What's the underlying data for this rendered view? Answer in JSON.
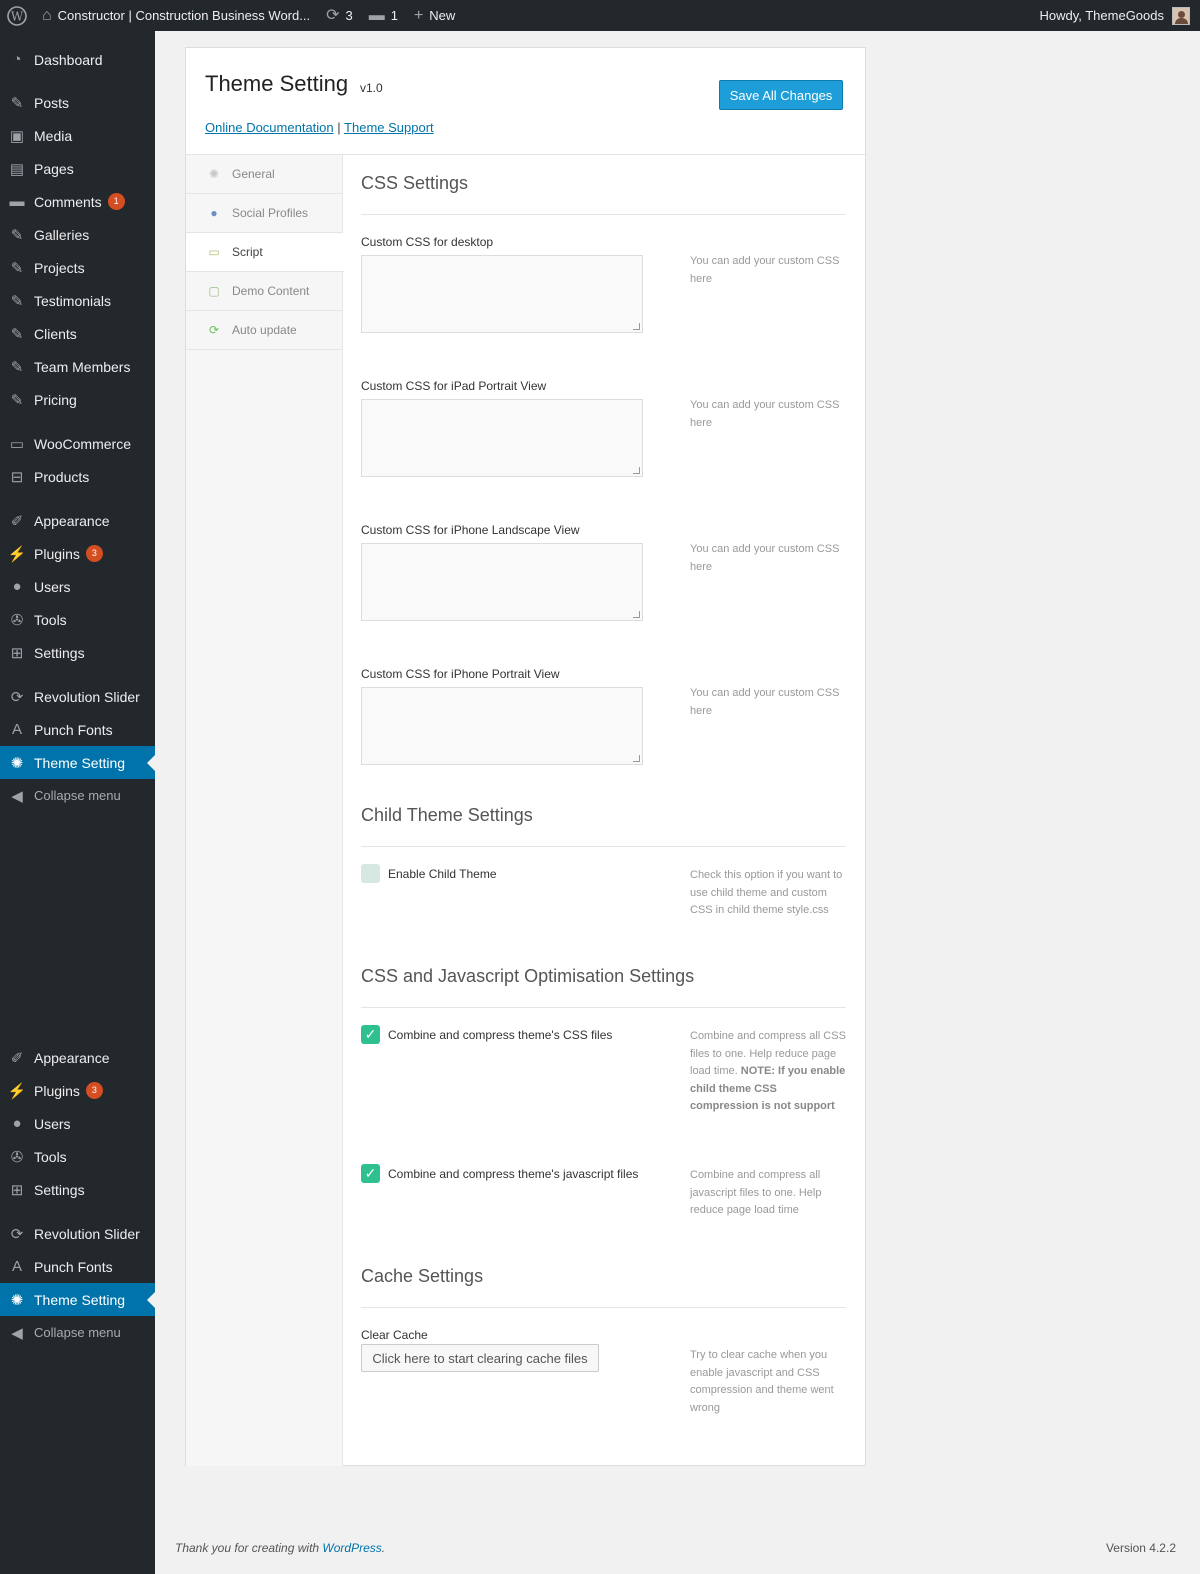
{
  "admin_bar": {
    "site_name": "Constructor | Construction Business Word...",
    "updates_count": "3",
    "comments_count": "1",
    "new_label": "New",
    "howdy": "Howdy, ThemeGoods"
  },
  "sidebar": {
    "items": [
      {
        "label": "Dashboard",
        "icon": "dashboard-icon"
      },
      {
        "label": "Posts",
        "icon": "pin-icon"
      },
      {
        "label": "Media",
        "icon": "media-icon"
      },
      {
        "label": "Pages",
        "icon": "pages-icon"
      },
      {
        "label": "Comments",
        "icon": "comments-icon",
        "badge": "1"
      },
      {
        "label": "Galleries",
        "icon": "edit-icon"
      },
      {
        "label": "Projects",
        "icon": "edit-icon"
      },
      {
        "label": "Testimonials",
        "icon": "edit-icon"
      },
      {
        "label": "Clients",
        "icon": "edit-icon"
      },
      {
        "label": "Team Members",
        "icon": "edit-icon"
      },
      {
        "label": "Pricing",
        "icon": "edit-icon"
      },
      {
        "label": "WooCommerce",
        "icon": "woo-icon"
      },
      {
        "label": "Products",
        "icon": "cart-icon"
      },
      {
        "label": "Appearance",
        "icon": "brush-icon"
      },
      {
        "label": "Plugins",
        "icon": "plug-icon",
        "badge": "3"
      },
      {
        "label": "Users",
        "icon": "user-icon"
      },
      {
        "label": "Tools",
        "icon": "wrench-icon"
      },
      {
        "label": "Settings",
        "icon": "settings-icon"
      },
      {
        "label": "Revolution Slider",
        "icon": "refresh-icon"
      },
      {
        "label": "Punch Fonts",
        "icon": "font-icon"
      },
      {
        "label": "Theme Setting",
        "icon": "gear-icon",
        "current": true
      },
      {
        "label": "Collapse menu",
        "icon": "collapse-icon"
      }
    ],
    "repeat_items": [
      {
        "label": "Appearance",
        "icon": "brush-icon"
      },
      {
        "label": "Plugins",
        "icon": "plug-icon",
        "badge": "3"
      },
      {
        "label": "Users",
        "icon": "user-icon"
      },
      {
        "label": "Tools",
        "icon": "wrench-icon"
      },
      {
        "label": "Settings",
        "icon": "settings-icon"
      },
      {
        "label": "Revolution Slider",
        "icon": "refresh-icon"
      },
      {
        "label": "Punch Fonts",
        "icon": "font-icon"
      },
      {
        "label": "Theme Setting",
        "icon": "gear-icon",
        "current": true
      },
      {
        "label": "Collapse menu",
        "icon": "collapse-icon"
      }
    ]
  },
  "header": {
    "title": "Theme Setting",
    "version": "v1.0",
    "doc_link": "Online Documentation",
    "separator": "|",
    "support_link": "Theme Support",
    "save_label": "Save All Changes"
  },
  "tabs": [
    {
      "label": "General",
      "icon": "gear-icon"
    },
    {
      "label": "Social Profiles",
      "icon": "social-icon"
    },
    {
      "label": "Script",
      "icon": "css-icon",
      "active": true
    },
    {
      "label": "Demo Content",
      "icon": "demo-icon"
    },
    {
      "label": "Auto update",
      "icon": "update-icon"
    }
  ],
  "css_settings": {
    "title": "CSS Settings",
    "fields": [
      {
        "label": "Custom CSS for desktop",
        "help": "You can add your custom CSS here"
      },
      {
        "label": "Custom CSS for iPad Portrait View",
        "help": "You can add your custom CSS here"
      },
      {
        "label": "Custom CSS for iPhone Landscape View",
        "help": "You can add your custom CSS here"
      },
      {
        "label": "Custom CSS for iPhone Portrait View",
        "help": "You can add your custom CSS here"
      }
    ]
  },
  "child_theme": {
    "title": "Child Theme Settings",
    "label": "Enable Child Theme",
    "checked": false,
    "help": "Check this option if you want to use child theme and custom CSS in child theme style.css"
  },
  "optimisation": {
    "title": "CSS and Javascript Optimisation Settings",
    "css_label": "Combine and compress theme's CSS files",
    "css_checked": true,
    "css_help": "Combine and compress all CSS files to one. Help reduce page load time.",
    "css_note": "NOTE: If you enable child theme CSS compression is not support",
    "js_label": "Combine and compress theme's javascript files",
    "js_checked": true,
    "js_help": "Combine and compress all javascript files to one. Help reduce page load time"
  },
  "cache": {
    "title": "Cache Settings",
    "label": "Clear Cache",
    "button": "Click here to start clearing cache files",
    "help": "Try to clear cache when you enable javascript and CSS compression and theme went wrong"
  },
  "footer": {
    "thanks": "Thank you for creating with",
    "wp_link": "WordPress",
    "period": ".",
    "version": "Version 4.2.2"
  }
}
